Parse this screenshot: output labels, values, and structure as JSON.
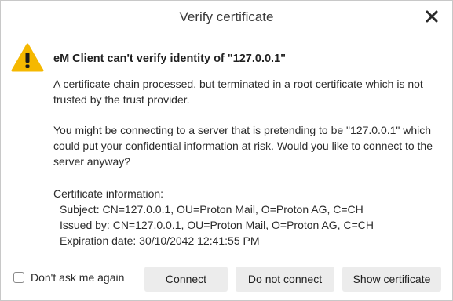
{
  "window": {
    "title": "Verify certificate"
  },
  "message": {
    "heading": "eM Client can't verify identity of \"127.0.0.1\"",
    "paragraph1": "A certificate chain processed, but terminated in a root certificate which is not trusted by the trust provider.",
    "paragraph2": "You might be connecting to a server that is pretending to be \"127.0.0.1\" which could put your confidential information at risk. Would you like to connect to the server anyway?"
  },
  "certificate": {
    "header": "Certificate information:",
    "subject": "Subject: CN=127.0.0.1, OU=Proton Mail, O=Proton AG, C=CH",
    "issued_by": "Issued by: CN=127.0.0.1, OU=Proton Mail, O=Proton AG, C=CH",
    "expiration": "Expiration date: 30/10/2042 12:41:55 PM"
  },
  "footer": {
    "dont_ask_label": "Don't ask me again",
    "dont_ask_checked": false,
    "connect_label": "Connect",
    "do_not_connect_label": "Do not connect",
    "show_certificate_label": "Show certificate"
  },
  "icons": {
    "warning": "warning-triangle-icon",
    "close": "close-icon"
  },
  "colors": {
    "warning_fill": "#f5b800",
    "button_bg": "#ececec"
  }
}
